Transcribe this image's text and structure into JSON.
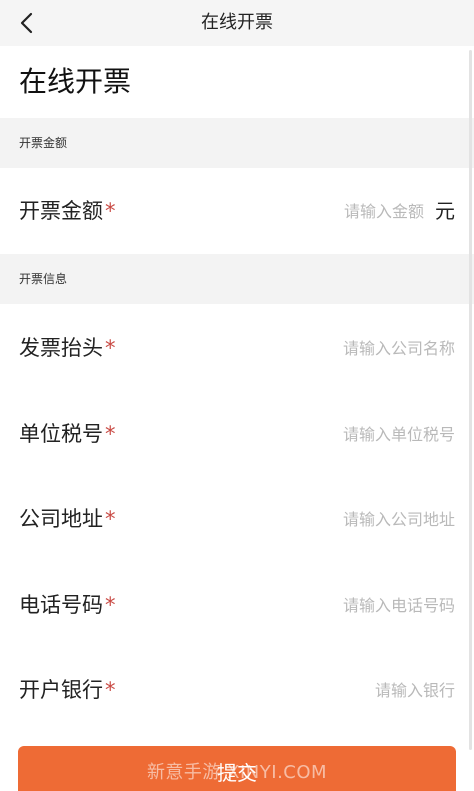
{
  "header": {
    "title": "在线开票",
    "back_icon": "chevron-left-icon"
  },
  "page": {
    "title": "在线开票"
  },
  "sections": {
    "amount": {
      "title": "开票金额"
    },
    "info": {
      "title": "开票信息"
    }
  },
  "fields": {
    "amount": {
      "label": "开票金额",
      "required": "*",
      "placeholder": "请输入金额",
      "value": "",
      "unit": "元"
    },
    "invoice_title": {
      "label": "发票抬头",
      "required": "*",
      "placeholder": "请输入公司名称",
      "value": ""
    },
    "tax_id": {
      "label": "单位税号",
      "required": "*",
      "placeholder": "请输入单位税号",
      "value": ""
    },
    "address": {
      "label": "公司地址",
      "required": "*",
      "placeholder": "请输入公司地址",
      "value": ""
    },
    "phone": {
      "label": "电话号码",
      "required": "*",
      "placeholder": "请输入电话号码",
      "value": ""
    },
    "bank": {
      "label": "开户银行",
      "required": "*",
      "placeholder": "请输入银行",
      "value": ""
    }
  },
  "submit": {
    "label": "提交"
  },
  "watermark": {
    "text": "新意手游 XINYI.COM"
  },
  "colors": {
    "accent": "#ee6b35",
    "required": "#c94a44"
  }
}
